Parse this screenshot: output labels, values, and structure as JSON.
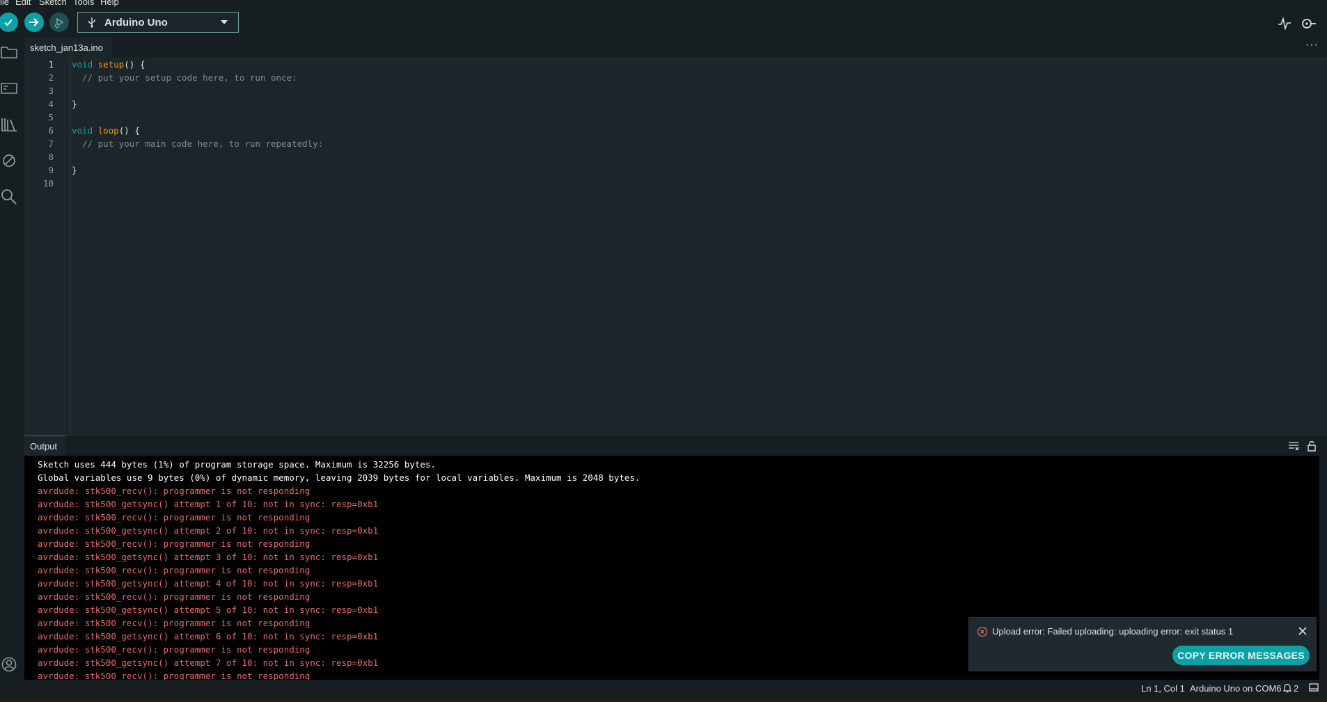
{
  "menu": {
    "items": [
      "ile",
      "Edit",
      "Sketch",
      "Tools",
      "Help"
    ]
  },
  "toolbar": {
    "verify_icon": "checkmark-icon",
    "upload_icon": "arrow-right-icon",
    "debug_icon": "debug-icon",
    "board_name": "Arduino Uno",
    "accent": "#0ca1a6"
  },
  "tabs": {
    "file_tab": "sketch_jan13a.ino",
    "more": "···"
  },
  "editor": {
    "lines": [
      {
        "n": "1"
      },
      {
        "n": "2"
      },
      {
        "n": "3"
      },
      {
        "n": "4"
      },
      {
        "n": "5"
      },
      {
        "n": "6"
      },
      {
        "n": "7"
      },
      {
        "n": "8"
      },
      {
        "n": "9"
      },
      {
        "n": "10"
      }
    ],
    "code": {
      "l1_kw": "void",
      "l1_fn": "setup",
      "l1_rest": "() {",
      "l2": "  // put your setup code here, to run once:",
      "l4": "}",
      "l6_kw": "void",
      "l6_fn": "loop",
      "l6_rest": "() {",
      "l7": "  // put your main code here, to run repeatedly:",
      "l9": "}"
    }
  },
  "output": {
    "tab_label": "Output",
    "lines": [
      {
        "type": "info",
        "text": "Sketch uses 444 bytes (1%) of program storage space. Maximum is 32256 bytes."
      },
      {
        "type": "info",
        "text": "Global variables use 9 bytes (0%) of dynamic memory, leaving 2039 bytes for local variables. Maximum is 2048 bytes."
      },
      {
        "type": "err",
        "text": "avrdude: stk500_recv(): programmer is not responding"
      },
      {
        "type": "err",
        "text": "avrdude: stk500_getsync() attempt 1 of 10: not in sync: resp=0xb1"
      },
      {
        "type": "err",
        "text": "avrdude: stk500_recv(): programmer is not responding"
      },
      {
        "type": "err",
        "text": "avrdude: stk500_getsync() attempt 2 of 10: not in sync: resp=0xb1"
      },
      {
        "type": "err",
        "text": "avrdude: stk500_recv(): programmer is not responding"
      },
      {
        "type": "err",
        "text": "avrdude: stk500_getsync() attempt 3 of 10: not in sync: resp=0xb1"
      },
      {
        "type": "err",
        "text": "avrdude: stk500_recv(): programmer is not responding"
      },
      {
        "type": "err",
        "text": "avrdude: stk500_getsync() attempt 4 of 10: not in sync: resp=0xb1"
      },
      {
        "type": "err",
        "text": "avrdude: stk500_recv(): programmer is not responding"
      },
      {
        "type": "err",
        "text": "avrdude: stk500_getsync() attempt 5 of 10: not in sync: resp=0xb1"
      },
      {
        "type": "err",
        "text": "avrdude: stk500_recv(): programmer is not responding"
      },
      {
        "type": "err",
        "text": "avrdude: stk500_getsync() attempt 6 of 10: not in sync: resp=0xb1"
      },
      {
        "type": "err",
        "text": "avrdude: stk500_recv(): programmer is not responding"
      },
      {
        "type": "err",
        "text": "avrdude: stk500_getsync() attempt 7 of 10: not in sync: resp=0xb1"
      },
      {
        "type": "err",
        "text": "avrdude: stk500_recv(): programmer is not responding"
      }
    ]
  },
  "notification": {
    "message": "Upload error: Failed uploading: uploading error: exit status 1",
    "button": "COPY ERROR MESSAGES",
    "error_color": "#e76a64"
  },
  "status": {
    "position": "Ln 1, Col 1",
    "board": "Arduino Uno on COM6",
    "notifications_count": "2"
  }
}
